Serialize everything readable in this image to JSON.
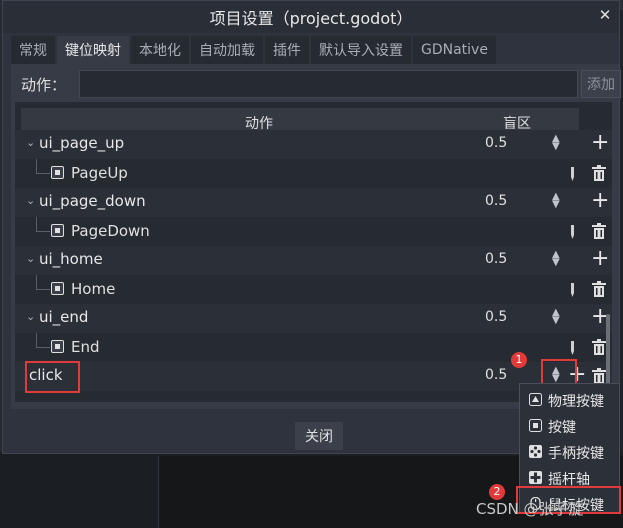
{
  "dialog": {
    "title": "项目设置（project.godot）",
    "close_symbol": "✕",
    "tabs": [
      "常规",
      "键位映射",
      "本地化",
      "自动加载",
      "插件",
      "默认导入设置",
      "GDNative"
    ],
    "active_tab": "键位映射"
  },
  "action_bar": {
    "label": "动作：",
    "input_value": "",
    "add_label": "添加"
  },
  "tree": {
    "columns": {
      "action": "动作",
      "deadzone": "盲区"
    },
    "rows": [
      {
        "name": "ui_page_up",
        "deadzone": "0.5",
        "event": "PageUp"
      },
      {
        "name": "ui_page_down",
        "deadzone": "0.5",
        "event": "PageDown"
      },
      {
        "name": "ui_home",
        "deadzone": "0.5",
        "event": "Home"
      },
      {
        "name": "ui_end",
        "deadzone": "0.5",
        "event": "End"
      },
      {
        "name": "click",
        "deadzone": "0.5"
      }
    ]
  },
  "footer": {
    "close_label": "关闭"
  },
  "popup_menu": {
    "items": [
      "物理按键",
      "按键",
      "手柄按键",
      "摇杆轴",
      "鼠标按键"
    ]
  },
  "annotations": {
    "badge1": "1",
    "badge2": "2"
  },
  "watermark": "CSDN @张子旋",
  "colors": {
    "highlight": "#e03a3a",
    "panel": "#363b45",
    "tree_bg": "#262a31"
  }
}
